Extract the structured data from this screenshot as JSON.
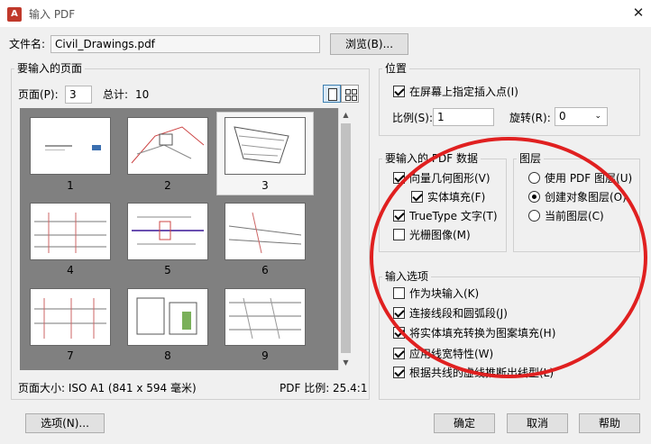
{
  "window": {
    "title": "输入 PDF",
    "icon": "pdf-app-icon",
    "close": "✕"
  },
  "file": {
    "label": "文件名:",
    "value": "Civil_Drawings.pdf",
    "browse": "浏览(B)..."
  },
  "pages": {
    "group_label": "要输入的页面",
    "page_label": "页面(P):",
    "page_value": "3",
    "total_label": "总计:",
    "total_value": "10",
    "thumbnails": [
      "1",
      "2",
      "3",
      "4",
      "5",
      "6",
      "7",
      "8",
      "9"
    ],
    "selected": "3",
    "page_size": "页面大小: ISO A1 (841 x 594 毫米)",
    "pdf_scale": "PDF 比例: 25.4:1"
  },
  "position": {
    "group_label": "位置",
    "specify_onscreen": "在屏幕上指定插入点(I)",
    "specify_checked": true,
    "scale_label": "比例(S):",
    "scale_value": "1",
    "rotation_label": "旋转(R):",
    "rotation_value": "0"
  },
  "pdf_data": {
    "group_label": "要输入的 PDF 数据",
    "items": [
      {
        "label": "向量几何图形(V)",
        "checked": true
      },
      {
        "label": "实体填充(F)",
        "checked": true
      },
      {
        "label": "TrueType 文字(T)",
        "checked": true
      },
      {
        "label": "光栅图像(M)",
        "checked": false
      }
    ]
  },
  "layers": {
    "group_label": "图层",
    "options": [
      {
        "label": "使用 PDF 图层(U)",
        "checked": false
      },
      {
        "label": "创建对象图层(O)",
        "checked": true
      },
      {
        "label": "当前图层(C)",
        "checked": false
      }
    ]
  },
  "import_options": {
    "group_label": "输入选项",
    "items": [
      {
        "label": "作为块输入(K)",
        "checked": false
      },
      {
        "label": "连接线段和圆弧段(J)",
        "checked": true
      },
      {
        "label": "将实体填充转换为图案填充(H)",
        "checked": true
      },
      {
        "label": "应用线宽特性(W)",
        "checked": true
      },
      {
        "label": "根据共线的虚线推断出线型(L)",
        "checked": true
      }
    ]
  },
  "buttons": {
    "options": "选项(N)...",
    "ok": "确定",
    "cancel": "取消",
    "help": "帮助"
  },
  "colors": {
    "highlight": "#e02020",
    "thumb_bg": "#808080"
  }
}
